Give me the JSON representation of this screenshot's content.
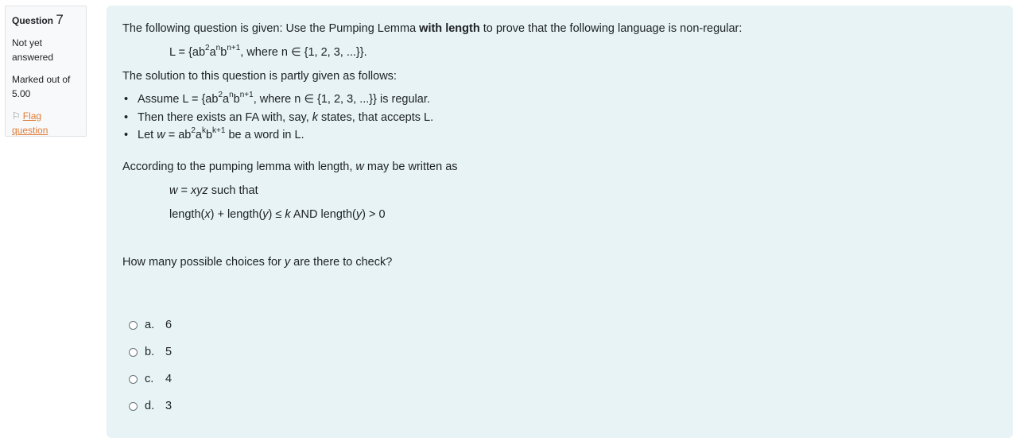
{
  "info": {
    "question_label": "Question",
    "question_number": "7",
    "state": "Not yet answered",
    "grade": "Marked out of 5.00",
    "flag_label": "Flag question"
  },
  "question": {
    "intro_1": "The following question is given: Use the Pumping Lemma ",
    "intro_bold": "with length",
    "intro_2": " to prove that the following language is non-regular:",
    "language_prefix": "L = {ab",
    "language_mid1": "a",
    "language_mid2": "b",
    "language_suffix": ", where n ∈ {1, 2, 3, ...}}.",
    "sup_2": "2",
    "sup_n": "n",
    "sup_n1": "n+1",
    "sup_k": "k",
    "sup_k1": "k+1",
    "solution_intro": "The solution to this question is partly given as follows:",
    "bullet1_prefix": "Assume L = {ab",
    "bullet1_suffix": ", where n ∈ {1, 2, 3, ...}} is regular.",
    "bullet2_a": "Then there exists an FA with, say, ",
    "bullet2_k": "k",
    "bullet2_b": " states, that accepts L.",
    "bullet3_a": "Let ",
    "bullet3_w": "w",
    "bullet3_b": " = ab",
    "bullet3_suffix": " be a word in L.",
    "pl_a": "According to the pumping lemma with length, ",
    "pl_w": "w",
    "pl_b": " may be written as",
    "eq1_w": "w",
    "eq1_eq": " = ",
    "eq1_xyz": "xyz",
    "eq1_rest": " such that",
    "eq2_a": "length(",
    "eq2_x": "x",
    "eq2_b": ") + length(",
    "eq2_y": "y",
    "eq2_c": ") ≤ ",
    "eq2_k": "k",
    "eq2_d": " AND length(",
    "eq2_y2": "y",
    "eq2_e": ") > 0",
    "ask_a": "How many possible choices for ",
    "ask_y": "y",
    "ask_b": " are there to check?"
  },
  "options": [
    {
      "letter": "a.",
      "value": "6"
    },
    {
      "letter": "b.",
      "value": "5"
    },
    {
      "letter": "c.",
      "value": "4"
    },
    {
      "letter": "d.",
      "value": "3"
    }
  ]
}
